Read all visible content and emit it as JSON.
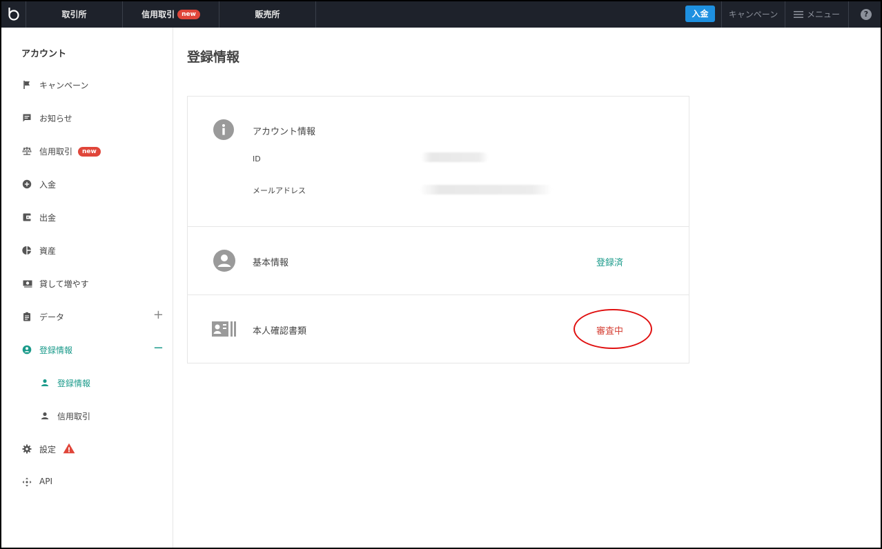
{
  "topnav": {
    "tabs": [
      {
        "label": "取引所"
      },
      {
        "label": "信用取引",
        "badge": "new"
      },
      {
        "label": "販売所"
      }
    ],
    "deposit_label": "入金",
    "campaign_label": "キャンペーン",
    "menu_label": "メニュー",
    "help_glyph": "?"
  },
  "sidebar": {
    "heading": "アカウント",
    "items": [
      {
        "label": "キャンペーン",
        "icon": "flag-icon"
      },
      {
        "label": "お知らせ",
        "icon": "message-icon"
      },
      {
        "label": "信用取引",
        "icon": "scale-icon",
        "badge": "new"
      },
      {
        "label": "入金",
        "icon": "plus-circle-icon"
      },
      {
        "label": "出金",
        "icon": "wallet-icon"
      },
      {
        "label": "資産",
        "icon": "pie-chart-icon"
      },
      {
        "label": "貸して増やす",
        "icon": "cash-icon"
      },
      {
        "label": "データ",
        "icon": "clipboard-icon",
        "toggle": "+"
      },
      {
        "label": "登録情報",
        "icon": "account-circle-icon",
        "toggle": "−",
        "active": true
      },
      {
        "label": "登録情報",
        "icon": "person-icon",
        "sub": true,
        "active": true
      },
      {
        "label": "信用取引",
        "icon": "person-icon",
        "sub": true
      },
      {
        "label": "設定",
        "icon": "gear-icon",
        "alert": "!"
      },
      {
        "label": "API",
        "icon": "api-icon"
      }
    ]
  },
  "main": {
    "title": "登録情報",
    "account": {
      "title": "アカウント情報",
      "id_label": "ID",
      "email_label": "メールアドレス"
    },
    "basic": {
      "title": "基本情報",
      "status": "登録済"
    },
    "identity": {
      "title": "本人確認書類",
      "status": "審査中"
    }
  },
  "colors": {
    "nav_bg": "#1e222b",
    "accent": "#1a9a8a",
    "deposit": "#1e90e0",
    "badge": "#e0463a",
    "pending": "#d6453a",
    "highlight_ring": "#e01010"
  }
}
